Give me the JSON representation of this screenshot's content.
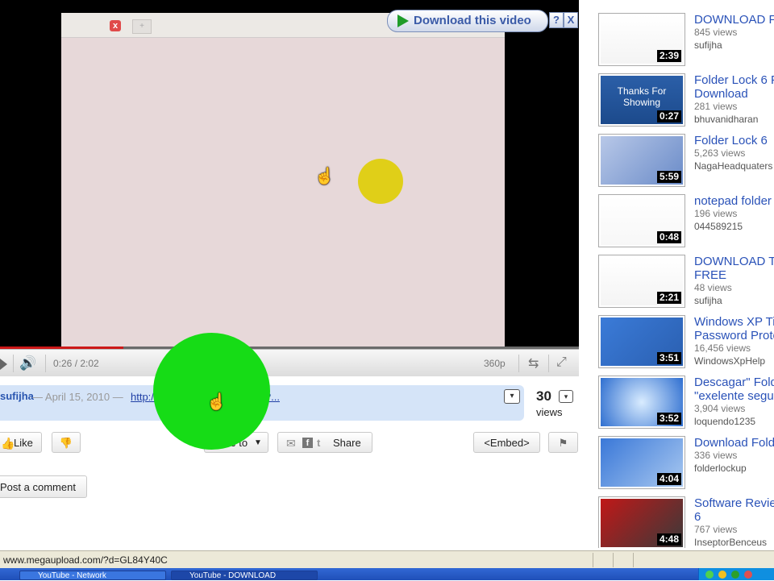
{
  "download_banner": {
    "label": "Download this video",
    "help": "?",
    "close": "X"
  },
  "inner_window": {
    "close": "x",
    "plus": "+"
  },
  "controls": {
    "time": "0:26 / 2:02",
    "quality": "360p",
    "progress_fraction": 0.213
  },
  "info": {
    "uploader": "sufijha",
    "date": "— April 15, 2010 —",
    "link": "http://www.megaupload.com/?...",
    "views_count": "30",
    "views_label": "views"
  },
  "actions": {
    "like": "Like",
    "save_to": "Save to",
    "share": "Share",
    "embed": "<Embed>",
    "post_comment": "Post a comment"
  },
  "related": [
    {
      "title": "DOWNLOAD F",
      "title2": "",
      "views": "845 views",
      "author": "sufijha",
      "duration": "2:39",
      "thumb_text": ""
    },
    {
      "title": "Folder Lock 6 F",
      "title2": "Download",
      "views": "281 views",
      "author": "bhuvanidharan",
      "duration": "0:27",
      "thumb_text": "Thanks For Showing"
    },
    {
      "title": "Folder Lock 6",
      "title2": "",
      "views": "5,263 views",
      "author": "NagaHeadquaters",
      "duration": "5:59",
      "thumb_text": ""
    },
    {
      "title": "notepad folder l",
      "title2": "",
      "views": "196 views",
      "author": "044589215",
      "duration": "0:48",
      "thumb_text": ""
    },
    {
      "title": "DOWNLOAD T",
      "title2": "FREE",
      "views": "48 views",
      "author": "sufijha",
      "duration": "2:21",
      "thumb_text": ""
    },
    {
      "title": "Windows XP Ti",
      "title2": "Password Prote",
      "views": "16,456 views",
      "author": "WindowsXpHelp",
      "duration": "3:51",
      "thumb_text": ""
    },
    {
      "title": "Descagar\" Fold",
      "title2": "\"exelente segu",
      "views": "3,904 views",
      "author": "loquendo1235",
      "duration": "3:52",
      "thumb_text": ""
    },
    {
      "title": "Download Fold",
      "title2": "",
      "views": "336 views",
      "author": "folderlockup",
      "duration": "4:04",
      "thumb_text": ""
    },
    {
      "title": "Software Review",
      "title2": "6",
      "views": "767 views",
      "author": "InseptorBenceus",
      "duration": "4:48",
      "thumb_text": ""
    }
  ],
  "status": {
    "url": "www.megaupload.com/?d=GL84Y40C"
  },
  "taskbar": {
    "task1": "YouTube - Network",
    "task2": "YouTube - DOWNLOAD"
  },
  "colors": {
    "youtube_red": "#cc1818",
    "link_blue": "#2a52b8",
    "info_bg": "#d5e4f8"
  }
}
